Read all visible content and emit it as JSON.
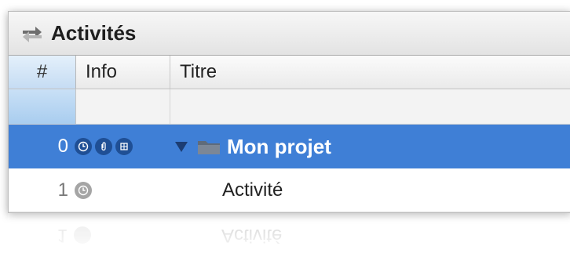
{
  "window": {
    "title": "Activités",
    "title_icon": "swap-arrows-icon"
  },
  "table": {
    "columns": {
      "num": "#",
      "info": "Info",
      "title": "Titre"
    },
    "rows": [
      {
        "num": "0",
        "title": "Mon projet",
        "selected": true,
        "expanded": true,
        "icons": [
          "clock-icon",
          "paperclip-icon",
          "grid-icon"
        ],
        "item_icon": "folder-icon"
      },
      {
        "num": "1",
        "title": "Activité",
        "selected": false,
        "icons": [
          "clock-icon"
        ]
      }
    ]
  },
  "colors": {
    "selection": "#3f7fd6",
    "header_highlight": "#c5dcf3",
    "badge": "#1f4f95"
  }
}
